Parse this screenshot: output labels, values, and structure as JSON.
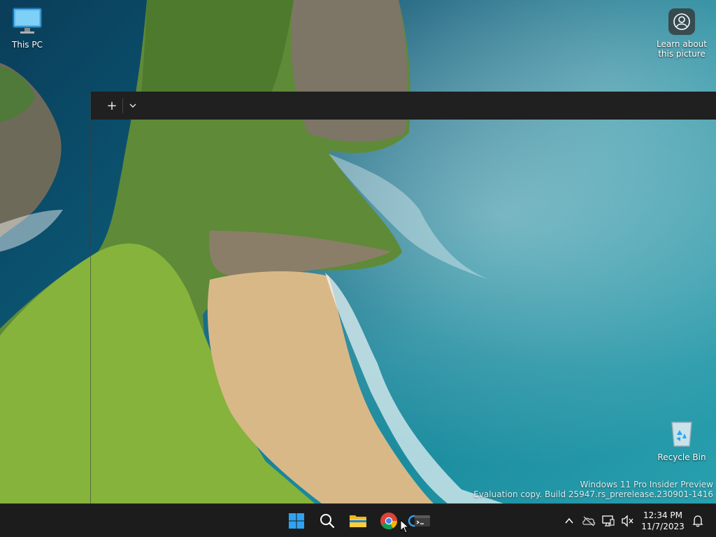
{
  "desktop": {
    "icons": [
      {
        "label": "This PC",
        "icon": "monitor-icon"
      },
      {
        "label": "Recycle Bin",
        "icon": "recycle-bin-icon"
      }
    ],
    "learn_about": {
      "label": "Learn about this picture",
      "icon": "camera-location-icon"
    },
    "watermark": {
      "line1": "Windows 11 Pro Insider Preview",
      "line2": "Evaluation copy. Build 25947.rs_prerelease.230901-1416"
    }
  },
  "terminal": {
    "new_tab_label": "+",
    "dropdown_label": "⌄"
  },
  "taskbar": {
    "items": [
      {
        "name": "start-button",
        "icon": "windows-logo-icon"
      },
      {
        "name": "search-button",
        "icon": "search-icon"
      },
      {
        "name": "file-explorer-button",
        "icon": "folder-icon"
      },
      {
        "name": "chrome-button",
        "icon": "chrome-icon"
      },
      {
        "name": "terminal-button",
        "icon": "terminal-icon"
      }
    ],
    "tray": {
      "chevron": "^",
      "icons": [
        "chevron-up-icon",
        "onedrive-offline-icon",
        "network-icon",
        "volume-muted-icon"
      ],
      "time": "12:34 PM",
      "date": "11/7/2023",
      "notification_icon": "bell-icon"
    }
  },
  "colors": {
    "taskbar_bg": "#1c1c1c",
    "titlebar_bg": "#202020",
    "accent_start": "#2ea3f2"
  }
}
